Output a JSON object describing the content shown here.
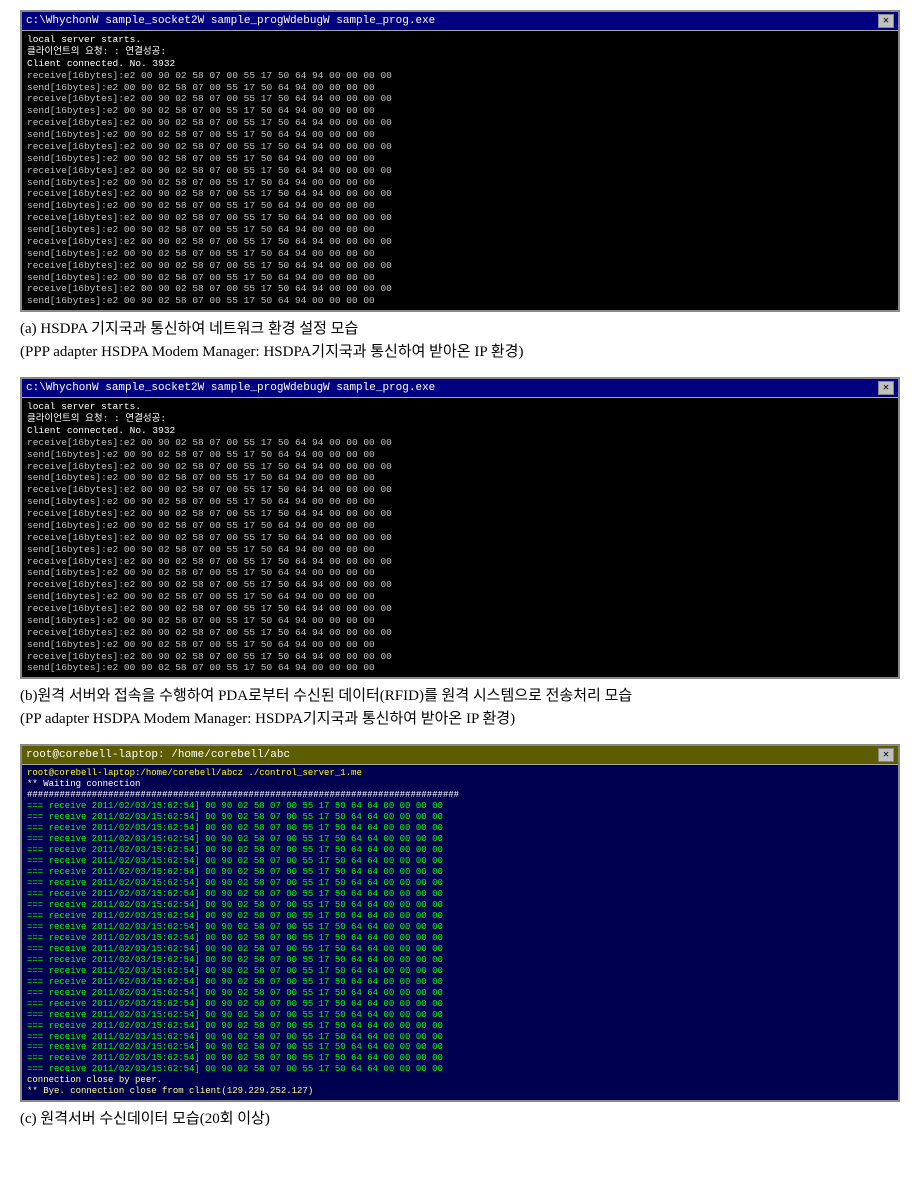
{
  "sections": [
    {
      "id": "section-a",
      "terminal": {
        "titlebar": "c:\\WhychonW sample_socket2W sample_progWdebugW sample_prog.exe",
        "lines": [
          "local server starts.",
          "클라이언트의   요청: :  연결성공:",
          "Client connected. No.   3932",
          "receive[16bytes]:e2 00 90 02 58 07 00 55 17 50 64 94 00 00 00 00",
          "send[16bytes]:e2 00 90 02 58 07 00 55 17 50 64 94 00 00 00 00",
          "receive[16bytes]:e2 00 90 02 58 07 00 55 17 50 64 94 00 00 00 00",
          "send[16bytes]:e2 00 90 02 58 07 00 55 17 50 64 94 00 00 00 00",
          "receive[16bytes]:e2 00 90 02 58 07 00 55 17 50 64 94 00 00 00 00",
          "send[16bytes]:e2 00 90 02 58 07 00 55 17 50 64 94 00 00 00 00",
          "receive[16bytes]:e2 00 90 02 58 07 00 55 17 50 64 94 00 00 00 00",
          "send[16bytes]:e2 00 90 02 58 07 00 55 17 50 64 94 00 00 00 00",
          "receive[16bytes]:e2 00 90 02 58 07 00 55 17 50 64 94 00 00 00 00",
          "send[16bytes]:e2 00 90 02 58 07 00 55 17 50 64 94 00 00 00 00",
          "receive[16bytes]:e2 00 90 02 58 07 00 55 17 50 64 94 00 00 00 00",
          "send[16bytes]:e2 00 90 02 58 07 00 55 17 50 64 94 00 00 00 00",
          "receive[16bytes]:e2 00 90 02 58 07 00 55 17 50 64 94 00 00 00 00",
          "send[16bytes]:e2 00 90 02 58 07 00 55 17 50 64 94 00 00 00 00",
          "receive[16bytes]:e2 00 90 02 58 07 00 55 17 50 64 94 00 00 00 00",
          "send[16bytes]:e2 00 90 02 58 07 00 55 17 50 64 94 00 00 00 00",
          "receive[16bytes]:e2 00 90 02 58 07 00 55 17 50 64 94 00 00 00 00",
          "send[16bytes]:e2 00 90 02 58 07 00 55 17 50 64 94 00 00 00 00",
          "receive[16bytes]:e2 00 90 02 58 07 00 55 17 50 64 94 00 00 00 00",
          "send[16bytes]:e2 00 90 02 58 07 00 55 17 50 64 94 00 00 00 00"
        ]
      },
      "caption_main": "(a) HSDPA 기지국과 통신하여 네트워크 환경 설정 모습",
      "caption_sub": "(PPP adapter HSDPA Modem Manager: HSDPA기지국과 통신하여 받아온 IP 환경)"
    },
    {
      "id": "section-b",
      "terminal": {
        "titlebar": "c:\\WhychonW sample_socket2W sample_progWdebugW sample_prog.exe",
        "lines": [
          "local server starts.",
          "클라이언트의   요청: :  연결성공:",
          "Client connected. No.   3932",
          "receive[16bytes]:e2 00 90 02 58 07 00 55 17 50 64 94 00 00 00 00",
          "send[16bytes]:e2 00 90 02 58 07 00 55 17 50 64 94 00 00 00 00",
          "receive[16bytes]:e2 00 90 02 58 07 00 55 17 50 64 94 00 00 00 00",
          "send[16bytes]:e2 00 90 02 58 07 00 55 17 50 64 94 00 00 00 00",
          "receive[16bytes]:e2 00 90 02 58 07 00 55 17 50 64 94 00 00 00 00",
          "send[16bytes]:e2 00 90 02 58 07 00 55 17 50 64 94 00 00 00 00",
          "receive[16bytes]:e2 00 90 02 58 07 00 55 17 50 64 94 00 00 00 00",
          "send[16bytes]:e2 00 90 02 58 07 00 55 17 50 64 94 00 00 00 00",
          "receive[16bytes]:e2 00 90 02 58 07 00 55 17 50 64 94 00 00 00 00",
          "send[16bytes]:e2 00 90 02 58 07 00 55 17 50 64 94 00 00 00 00",
          "receive[16bytes]:e2 00 90 02 58 07 00 55 17 50 64 94 00 00 00 00",
          "send[16bytes]:e2 00 90 02 58 07 00 55 17 50 64 94 00 00 00 00",
          "receive[16bytes]:e2 00 90 02 58 07 00 55 17 50 64 94 00 00 00 00",
          "send[16bytes]:e2 00 90 02 58 07 00 55 17 50 64 94 00 00 00 00",
          "receive[16bytes]:e2 00 90 02 58 07 00 55 17 50 64 94 00 00 00 00",
          "send[16bytes]:e2 00 90 02 58 07 00 55 17 50 64 94 00 00 00 00",
          "receive[16bytes]:e2 00 90 02 58 07 00 55 17 50 64 94 00 00 00 00",
          "send[16bytes]:e2 00 90 02 58 07 00 55 17 50 64 94 00 00 00 00",
          "receive[16bytes]:e2 00 90 02 58 07 00 55 17 50 64 94 00 00 00 00",
          "send[16bytes]:e2 00 90 02 58 07 00 55 17 50 64 94 00 00 00 00"
        ]
      },
      "caption_main": "(b)원격 서버와 접속을 수행하여   PDA로부터 수신된 데이터(RFID)를 원격 시스템으로 전송처리 모습",
      "caption_sub": " (PP adapter HSDPA Modem Manager:  HSDPA기지국과 통신하여 받아온 IP 환경)"
    },
    {
      "id": "section-c",
      "terminal": {
        "titlebar": "root@corebell-laptop: /home/corebell/abc",
        "lines_top": [
          "root@corebell-laptop:/home/corebell/abcz ./control_server_1.me",
          "** Waiting connection",
          "################################################################################",
          "=== receive 2011/02/03/15:62:54]     00 90 02 58 07 00 55 17 50 64 64 00 00 00 00",
          "=== receive 2011/02/03/15:62:54]     00 90 02 58 07 00 55 17 50 64 64 00 00 00 00",
          "=== receive 2011/02/03/15:62:54]     00 90 02 58 07 00 55 17 50 64 64 00 00 00 00",
          "=== receive 2011/02/03/15:62:54]     00 90 02 58 07 00 55 17 50 64 64 00 00 00 00",
          "=== receive 2011/02/03/15:62:54]     00 90 02 58 07 00 55 17 50 64 64 00 00 00 00",
          "=== receive 2011/02/03/15:62:54]     00 90 02 58 07 00 55 17 50 64 64 00 00 00 00",
          "=== receive 2011/02/03/15:62:54]     00 90 02 58 07 00 55 17 50 64 64 00 00 00 00",
          "=== receive 2011/02/03/15:62:54]     00 90 02 58 07 00 55 17 50 64 64 00 00 00 00",
          "=== receive 2011/02/03/15:62:54]     00 90 02 58 07 00 55 17 50 64 64 00 00 00 00",
          "=== receive 2011/02/03/15:62:54]     00 90 02 58 07 00 55 17 50 64 64 00 00 00 00",
          "=== receive 2011/02/03/15:62:54]     00 90 02 58 07 00 55 17 50 64 64 00 00 00 00",
          "=== receive 2011/02/03/15:62:54]     00 90 02 58 07 00 55 17 50 64 64 00 00 00 00",
          "=== receive 2011/02/03/15:62:54]     00 90 02 58 07 00 55 17 50 64 64 00 00 00 00",
          "=== receive 2011/02/03/15:62:54]     00 90 02 58 07 00 55 17 50 64 64 00 00 00 00",
          "=== receive 2011/02/03/15:62:54]     00 90 02 58 07 00 55 17 50 64 64 00 00 00 00",
          "=== receive 2011/02/03/15:62:54]     00 90 02 58 07 00 55 17 50 64 64 00 00 00 00",
          "=== receive 2011/02/03/15:62:54]     00 90 02 58 07 00 55 17 50 64 64 00 00 00 00",
          "=== receive 2011/02/03/15:62:54]     00 90 02 58 07 00 55 17 50 64 64 00 00 00 00",
          "=== receive 2011/02/03/15:62:54]     00 90 02 58 07 00 55 17 50 64 64 00 00 00 00",
          "=== receive 2011/02/03/15:62:54]     00 90 02 58 07 00 55 17 50 64 64 00 00 00 00",
          "=== receive 2011/02/03/15:62:54]     00 90 02 58 07 00 55 17 50 64 64 00 00 00 00",
          "=== receive 2011/02/03/15:62:54]     00 90 02 58 07 00 55 17 50 64 64 00 00 00 00",
          "=== receive 2011/02/03/15:62:54]     00 90 02 58 07 00 55 17 50 64 64 00 00 00 00",
          "=== receive 2011/02/03/15:62:54]     00 90 02 58 07 00 55 17 50 64 64 00 00 00 00",
          "=== receive 2011/02/03/15:62:54]     00 90 02 58 07 00 55 17 50 64 64 00 00 00 00",
          "connection close by peer.",
          "** Bye. connection close from client(129.229.252.127)"
        ]
      },
      "caption_main": "(c)  원격서버 수신데이터 모습(20회 이상)"
    }
  ]
}
